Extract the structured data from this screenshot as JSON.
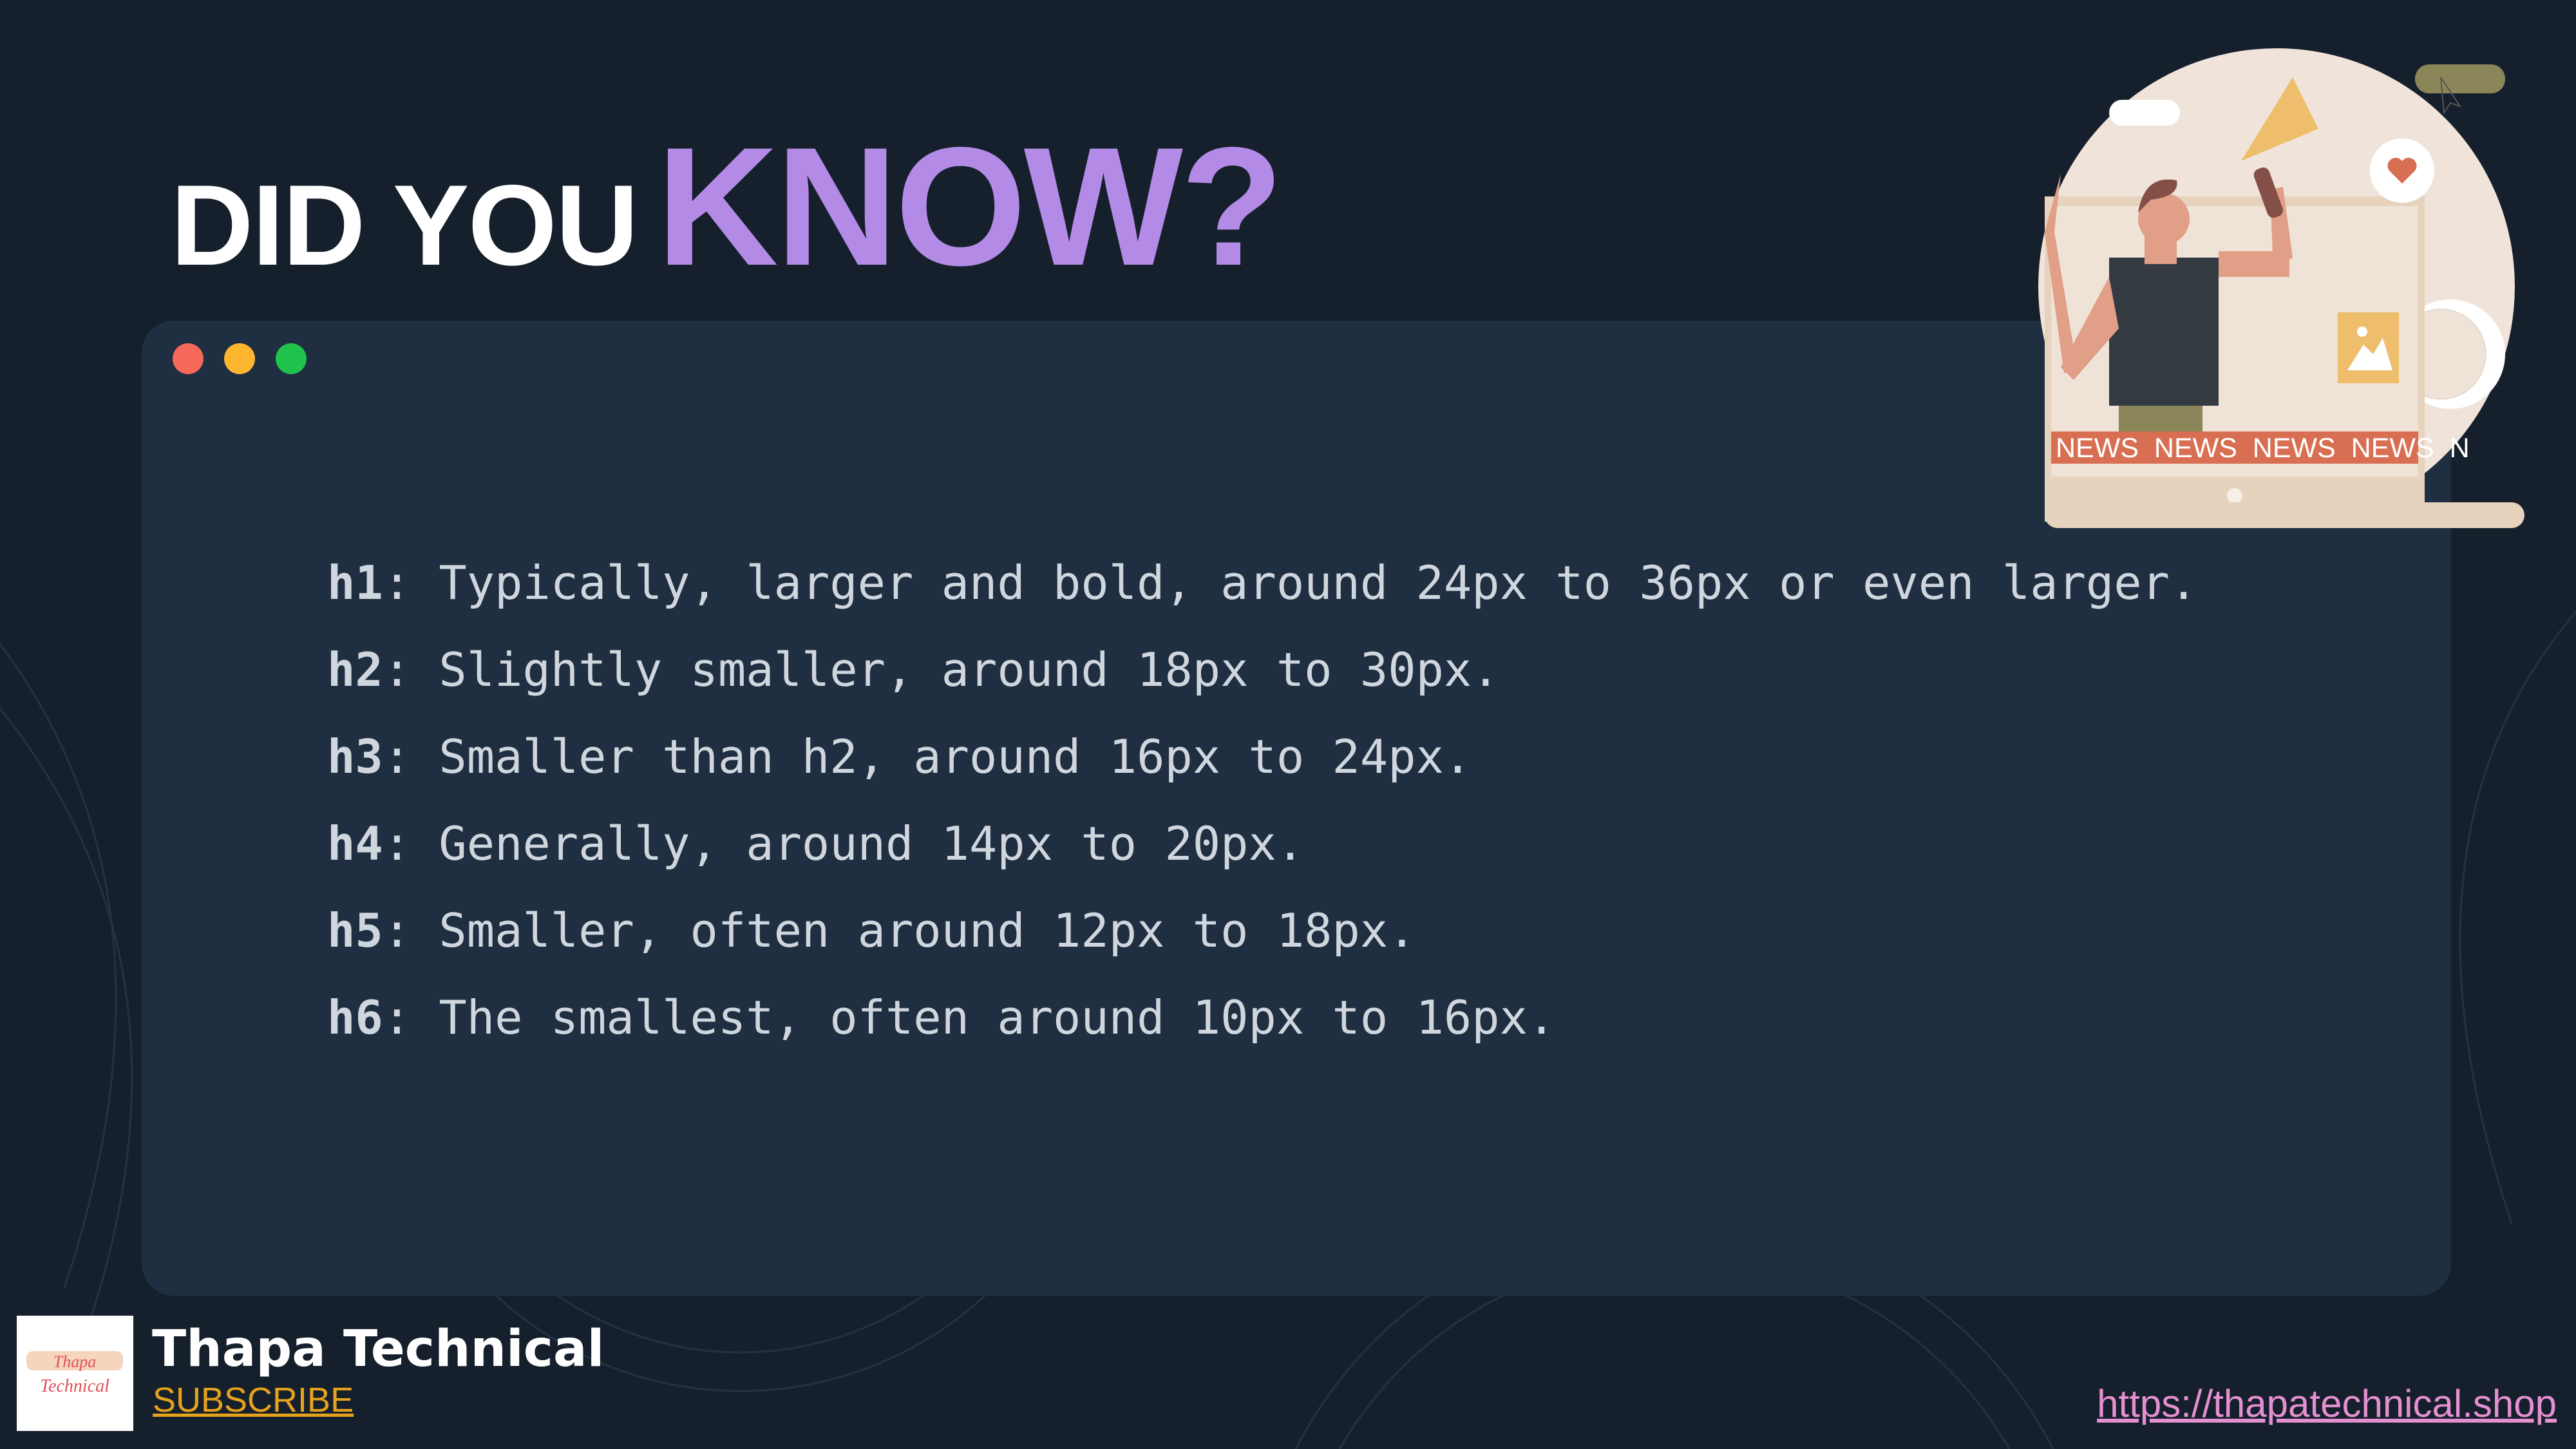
{
  "title": {
    "part1": "DID YOU",
    "part2": "KNOW?"
  },
  "window_dots": {
    "colors": [
      "#f5685a",
      "#ffb62f",
      "#1fc24a"
    ]
  },
  "lines": [
    {
      "key": "h1",
      "text": ": Typically, larger and bold, around 24px to 36px or even larger."
    },
    {
      "key": "h2",
      "text": ": Slightly smaller, around 18px to 30px."
    },
    {
      "key": "h3",
      "text": ": Smaller than h2, around 16px to 24px."
    },
    {
      "key": "h4",
      "text": ": Generally, around 14px to 20px."
    },
    {
      "key": "h5",
      "text": ": Smaller, often around 12px to 18px."
    },
    {
      "key": "h6",
      "text": ": The smallest, often around 10px to 16px."
    }
  ],
  "illustration": {
    "ticker": "NEWS  NEWS  NEWS  NEWS  N"
  },
  "footer": {
    "brand": "Thapa Technical",
    "subscribe": "SUBSCRIBE",
    "url": "https://thapatechnical.shop",
    "logo_text": "Thapa Technical"
  }
}
